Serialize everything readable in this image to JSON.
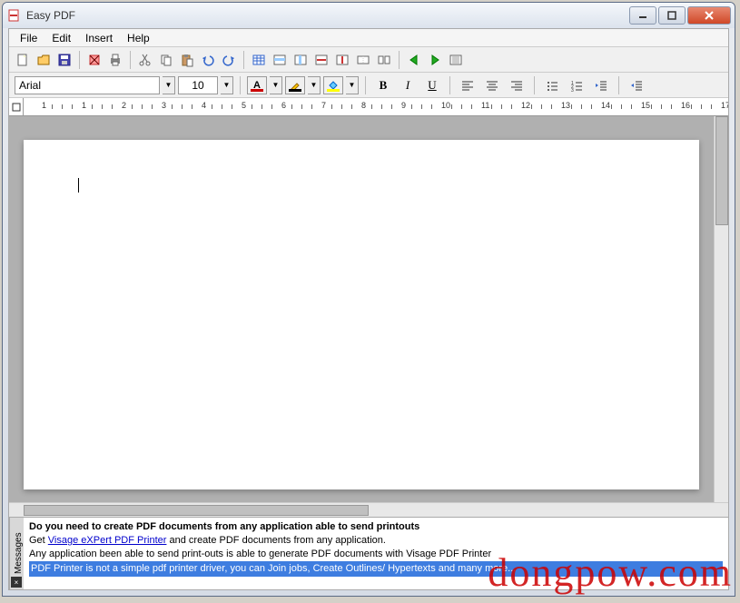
{
  "window": {
    "title": "Easy PDF"
  },
  "menu": {
    "items": [
      "File",
      "Edit",
      "Insert",
      "Help"
    ]
  },
  "toolbar1": {
    "icons": [
      "new-icon",
      "open-icon",
      "save-icon",
      "cut-format-icon",
      "print-icon",
      "cut-icon",
      "copy-icon",
      "paste-icon",
      "undo-icon",
      "redo-icon",
      "table-icon",
      "insert-row-icon",
      "insert-col-icon",
      "delete-row-icon",
      "delete-col-icon",
      "merge-icon",
      "split-icon",
      "prev-icon",
      "next-icon",
      "view-icon"
    ]
  },
  "format": {
    "font": "Arial",
    "size": "10",
    "bold": "B",
    "italic": "I",
    "underline": "U"
  },
  "ruler": {
    "numbers": [
      "1",
      "1",
      "2",
      "3",
      "4",
      "5",
      "6",
      "7",
      "8",
      "9",
      "10",
      "11",
      "12",
      "13",
      "14",
      "15",
      "16",
      "17"
    ]
  },
  "messages": {
    "tab_label": "Messages",
    "line1": "Do you need to create PDF documents from any application able to send printouts",
    "line2a": "Get ",
    "line2link": "Visage eXPert PDF Printer",
    "line2b": " and create PDF documents from any application.",
    "line3": "Any application been able to send print-outs is able to generate PDF documents with Visage PDF Printer",
    "line4": "PDF Printer is not a simple pdf printer driver, you can Join jobs, Create Outlines/ Hypertexts and many more..."
  },
  "watermark": "dongpow.com"
}
